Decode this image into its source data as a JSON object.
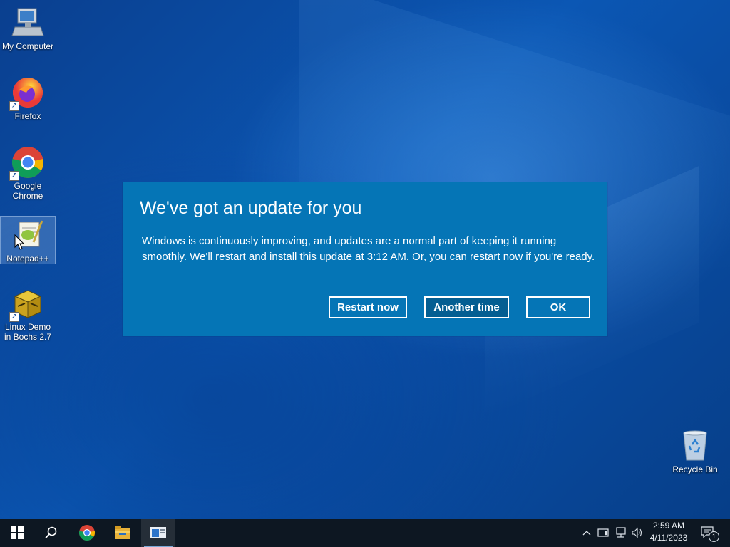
{
  "desktop": {
    "icons": [
      {
        "label": "My Computer"
      },
      {
        "label": "Firefox"
      },
      {
        "label": "Google Chrome"
      },
      {
        "label": "Notepad++"
      },
      {
        "label": "Linux Demo in Bochs 2.7"
      },
      {
        "label": "Recycle Bin"
      }
    ]
  },
  "dialog": {
    "title": "We've got an update for you",
    "body": "Windows is continuously improving, and updates are a normal part of keeping it running smoothly. We'll restart and install this update at 3:12 AM. Or, you can restart now if you're ready.",
    "buttons": {
      "restart_now": "Restart now",
      "another_time": "Another time",
      "ok": "OK"
    }
  },
  "taskbar": {
    "time": "2:59 AM",
    "date": "4/11/2023",
    "notification_count": "1",
    "pinned": [
      "start-icon",
      "search-icon",
      "chrome-icon",
      "file-explorer-icon",
      "app-window-icon"
    ],
    "tray_icons": [
      "chevron-up-icon",
      "security-icon",
      "network-icon",
      "volume-icon",
      "notifications-icon"
    ]
  },
  "colors": {
    "dialog_bg": "#0575b6",
    "taskbar_bg": "#0d1722",
    "desktop_accent": "#0b57b4"
  }
}
